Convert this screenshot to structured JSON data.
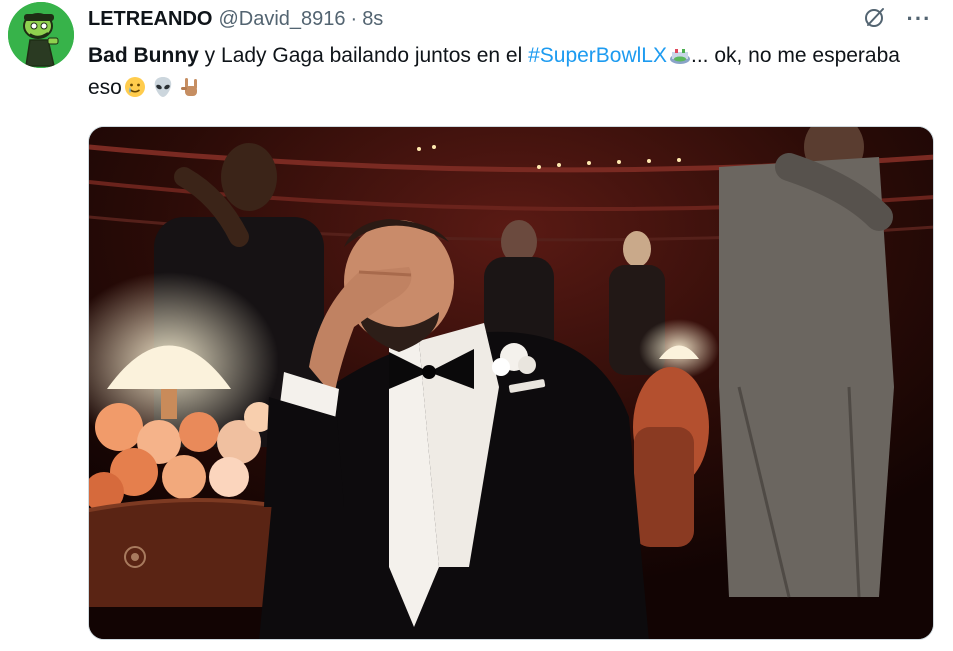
{
  "tweet": {
    "display_name": "LETREANDO",
    "handle": "@David_8916",
    "separator": "·",
    "time": "8s",
    "text_bold": "Bad Bunny",
    "text_part1": " y Lady Gaga bailando juntos en el ",
    "hashtag": "#SuperBowlLX",
    "text_part2": "... ok, no me esperaba eso",
    "emojis": [
      "stadium-emoji",
      "crying-smile-emoji",
      "alien-emoji",
      "rock-hand-emoji"
    ]
  },
  "actions": {
    "more_label": "···"
  },
  "media": {
    "description_icon": "photo-of-man-in-tuxedo-covering-eyes-at-awards-show"
  },
  "colors": {
    "hashtag": "#1d9bf0",
    "secondary_text": "#536471",
    "avatar_bg": "#37b34a"
  }
}
